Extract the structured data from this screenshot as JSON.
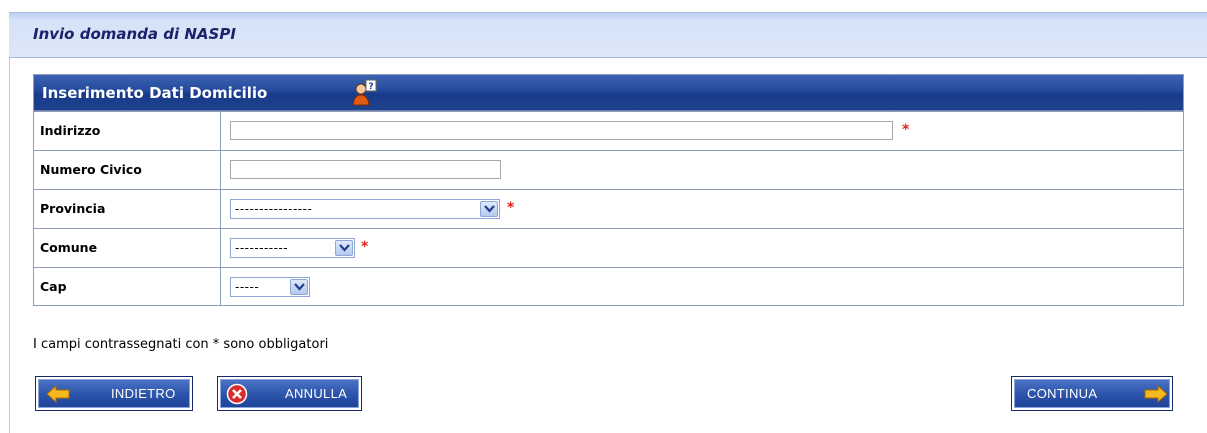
{
  "page": {
    "title": "Invio domanda di NASPI"
  },
  "panel": {
    "title": "Inserimento Dati Domicilio",
    "help_icon": "user-help-icon"
  },
  "fields": [
    {
      "label": "Indirizzo",
      "value": "",
      "required": true,
      "type": "text"
    },
    {
      "label": "Numero Civico",
      "value": "",
      "required": false,
      "type": "text"
    },
    {
      "label": "Provincia",
      "selected": "----------------",
      "required": true,
      "type": "select"
    },
    {
      "label": "Comune",
      "selected": "-----------",
      "required": true,
      "type": "select"
    },
    {
      "label": "Cap",
      "selected": "-----",
      "required": false,
      "type": "select"
    }
  ],
  "required_marker": "*",
  "footnote": "I campi contrassegnati con * sono obbligatori",
  "buttons": {
    "back": {
      "label": "INDIETRO",
      "icon": "arrow-left-icon"
    },
    "cancel": {
      "label": "ANNULLA",
      "icon": "cancel-x-icon"
    },
    "continue": {
      "label": "CONTINUA",
      "icon": "arrow-right-icon"
    }
  },
  "colors": {
    "header_bg": "#dce7f9",
    "panel_header": "#24499c",
    "button": "#2d56ad",
    "required": "#e02020"
  }
}
